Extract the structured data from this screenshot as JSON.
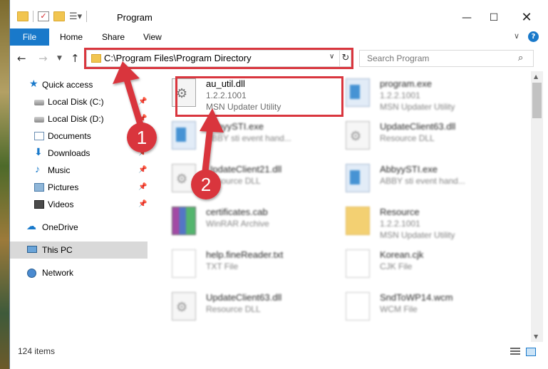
{
  "window": {
    "title": "Program",
    "controls": {
      "minimize": "—",
      "maximize": "☐",
      "close": "✕"
    }
  },
  "ribbon": {
    "tabs": [
      "File",
      "Home",
      "Share",
      "View"
    ],
    "collapse_icon": "chevron-down-icon",
    "help_label": "?"
  },
  "nav": {
    "address_path": "C:\\Program Files\\Program Directory",
    "search_placeholder": "Search Program"
  },
  "sidebar": {
    "items": [
      {
        "label": "Quick access",
        "icon": "star-icon",
        "pinned": false
      },
      {
        "label": "Local Disk (C:)",
        "icon": "disk-icon",
        "pinned": true
      },
      {
        "label": "Local Disk (D:)",
        "icon": "disk-icon",
        "pinned": true
      },
      {
        "label": "Documents",
        "icon": "documents-icon",
        "pinned": true
      },
      {
        "label": "Downloads",
        "icon": "downloads-icon",
        "pinned": true
      },
      {
        "label": "Music",
        "icon": "music-icon",
        "pinned": true
      },
      {
        "label": "Pictures",
        "icon": "pictures-icon",
        "pinned": true
      },
      {
        "label": "Videos",
        "icon": "videos-icon",
        "pinned": true
      },
      {
        "label": "OneDrive",
        "icon": "cloud-icon",
        "pinned": false
      },
      {
        "label": "This PC",
        "icon": "pc-icon",
        "pinned": false,
        "selected": true
      },
      {
        "label": "Network",
        "icon": "network-icon",
        "pinned": false
      }
    ]
  },
  "files": [
    {
      "name": "au_util.dll",
      "line2": "1.2.2.1001",
      "line3": "MSN Updater Utility",
      "icon": "gear-file-icon",
      "highlighted": true
    },
    {
      "name": "program.exe",
      "line2": "1.2.2.1001",
      "line3": "MSN Updater Utility",
      "icon": "exe-icon"
    },
    {
      "name": "AbbyySTI.exe",
      "line2": "ABBY sti event hand...",
      "line3": "",
      "icon": "exe-icon"
    },
    {
      "name": "UpdateClient63.dll",
      "line2": "Resource DLL",
      "line3": "",
      "icon": "gear-file-icon"
    },
    {
      "name": "UpdateClient21.dll",
      "line2": "Resource DLL",
      "line3": "",
      "icon": "gear-file-icon"
    },
    {
      "name": "AbbyySTI.exe",
      "line2": "ABBY sti event hand...",
      "line3": "",
      "icon": "exe-icon"
    },
    {
      "name": "certificates.cab",
      "line2": "WinRAR Archive",
      "line3": "",
      "icon": "winrar-icon"
    },
    {
      "name": "Resource",
      "line2": "1.2.2.1001",
      "line3": "MSN Updater Utility",
      "icon": "folder-icon"
    },
    {
      "name": "help.fineReader.txt",
      "line2": "TXT File",
      "line3": "",
      "icon": "document-icon"
    },
    {
      "name": "Korean.cjk",
      "line2": "CJK File",
      "line3": "",
      "icon": "document-icon"
    },
    {
      "name": "UpdateClient63.dll",
      "line2": "Resource DLL",
      "line3": "",
      "icon": "gear-file-icon"
    },
    {
      "name": "SndToWP14.wcm",
      "line2": "WCM File",
      "line3": "",
      "icon": "document-icon"
    }
  ],
  "annotations": {
    "callout_1": "1",
    "callout_2": "2",
    "color": "#d9363e"
  },
  "status": {
    "item_count": "124 items"
  },
  "colors": {
    "accent": "#1979ca",
    "highlight": "#d9363e"
  }
}
